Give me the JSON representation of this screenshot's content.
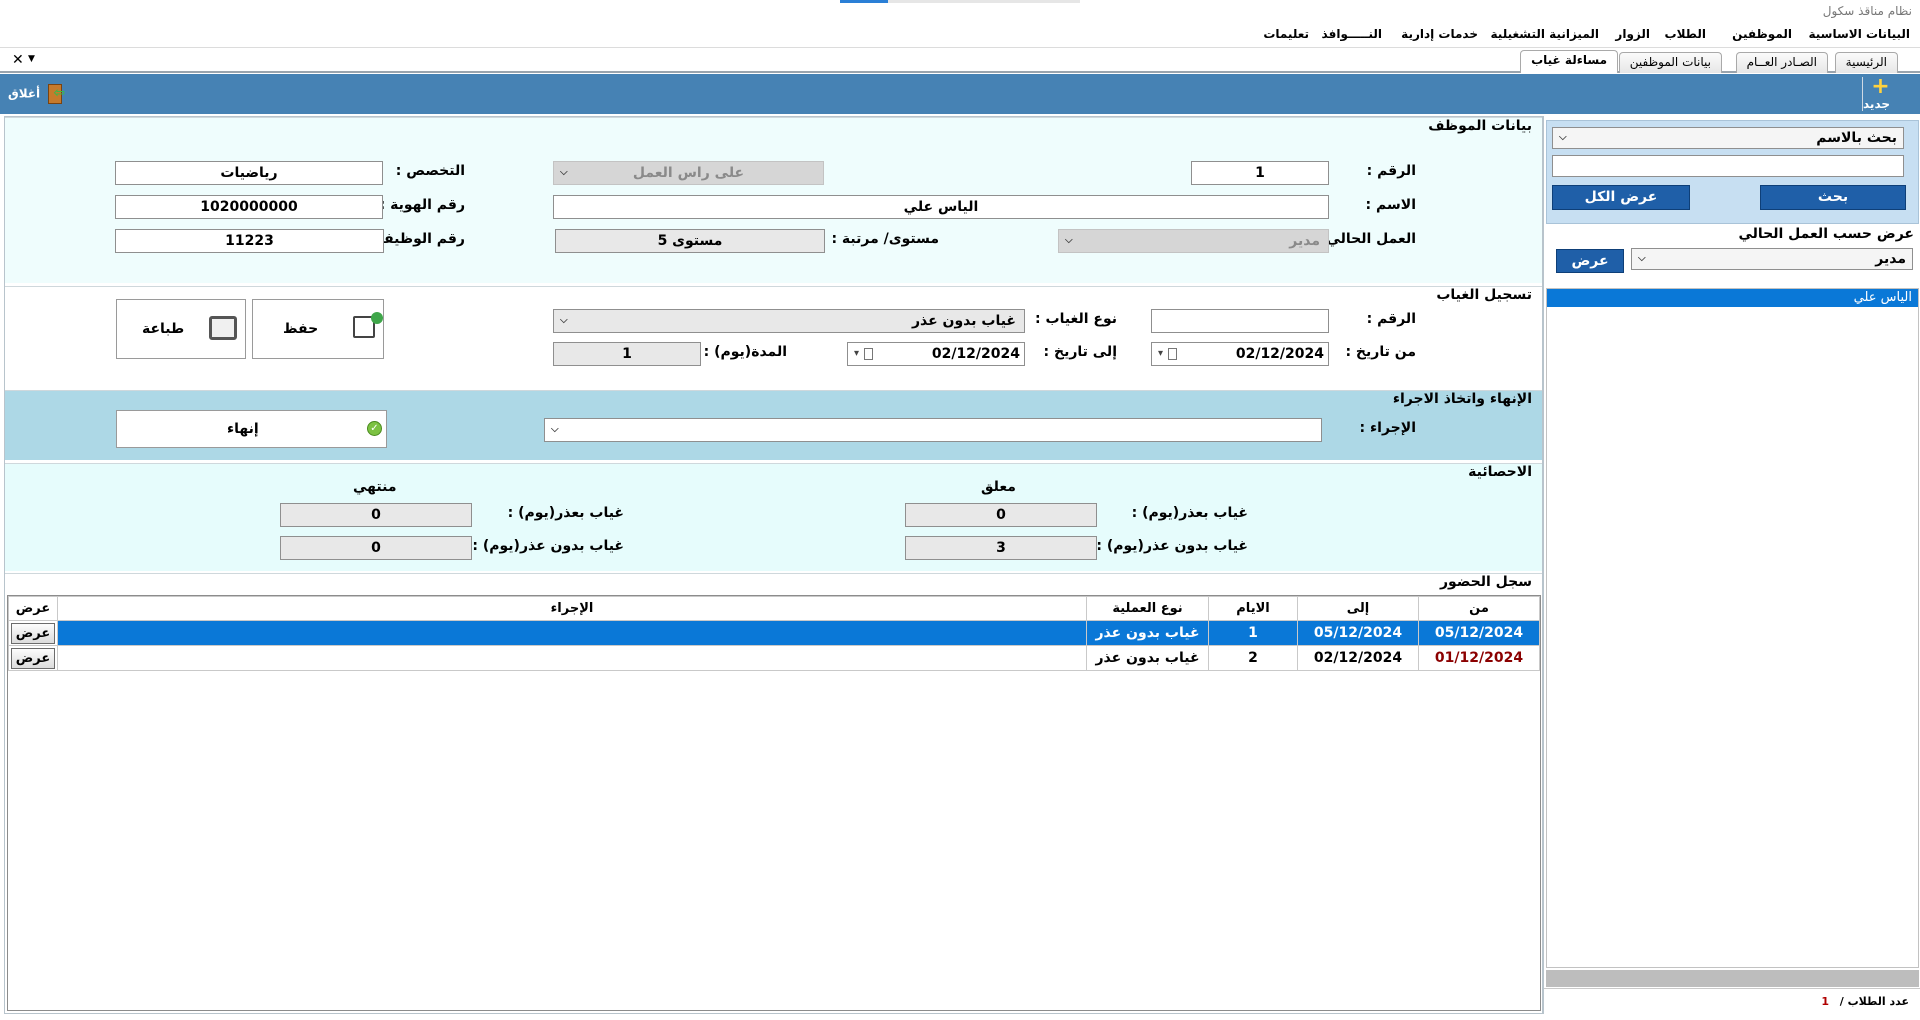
{
  "app": {
    "title": "نظام مناقذ سكول"
  },
  "menu": [
    "البيانات الاساسية",
    "الموظفين",
    "الطلاب",
    "الزوار",
    "الميزانية التشغيلية",
    "خدمات إدارية",
    "النـــــوافذ",
    "تعليمات"
  ],
  "tabs": [
    "الرئيسية",
    "الصـادر العــام",
    "بيانات الموظفين",
    "مساءلة غياب"
  ],
  "toolbar": {
    "new_label": "جديد",
    "close_label": "أغلاق"
  },
  "employee": {
    "section_title": "بيانات الموظف",
    "number_label": "الرقم :",
    "number": "1",
    "name_label": "الاسم :",
    "name": "الياس علي",
    "current_work_label": "العمل الحالي :",
    "current_work": "مدير",
    "on_duty": "على راس العمل",
    "level_label": "مستوى/ مرتبة :",
    "level": "مستوى 5",
    "specialty_label": "التخصص :",
    "specialty": "رياضيات",
    "id_label": "رقم الهوية :",
    "id_number": "1020000000",
    "job_no_label": "رقم الوظيفة :",
    "job_no": "11223"
  },
  "absence": {
    "section_title": "تسجيل الغياب",
    "number_label": "الرقم :",
    "number": "",
    "type_label": "نوع الغياب :",
    "type": "غياب بدون عذر",
    "from_label": "من تاريخ :",
    "from": "02/12/2024",
    "to_label": "إلى تاريخ :",
    "to": "02/12/2024",
    "duration_label": "المدة(يوم) :",
    "duration": "1",
    "save_label": "حفظ",
    "print_label": "طباعة"
  },
  "finish": {
    "section_title": "الإنهاء واتخاذ الاجراء",
    "action_label": "الإجراء :",
    "action": "",
    "finish_label": "إنهاء"
  },
  "stats": {
    "section_title": "الاحصائية",
    "pending_title": "معلق",
    "finished_title": "منتهي",
    "excused_label": "غياب بعذر(يوم) :",
    "unexcused_label": "غياب بدون عذر(يوم) :",
    "pending_excused": "0",
    "pending_unexcused": "3",
    "finished_excused": "0",
    "finished_unexcused": "0"
  },
  "attendance": {
    "section_title": "سجل الحضور",
    "columns": [
      "من",
      "إلى",
      "الايام",
      "نوع العملية",
      "الإجراء",
      "عرض"
    ],
    "rows": [
      {
        "from": "05/12/2024",
        "to": "05/12/2024",
        "days": "1",
        "type": "غياب بدون عذر",
        "action": "",
        "view": "عرض"
      },
      {
        "from": "01/12/2024",
        "to": "02/12/2024",
        "days": "2",
        "type": "غياب بدون عذر",
        "action": "",
        "view": "عرض"
      }
    ]
  },
  "sidebar": {
    "search_mode": "بحث بالاسم",
    "search_value": "",
    "search_button": "بحث",
    "show_all_button": "عرض الكل",
    "filter_title": "عرض حسب العمل الحالي",
    "filter_value": "مدير",
    "filter_button": "عرض",
    "names": [
      "الياس علي"
    ],
    "count_label": "عدد الطلاب /",
    "count": "1"
  }
}
